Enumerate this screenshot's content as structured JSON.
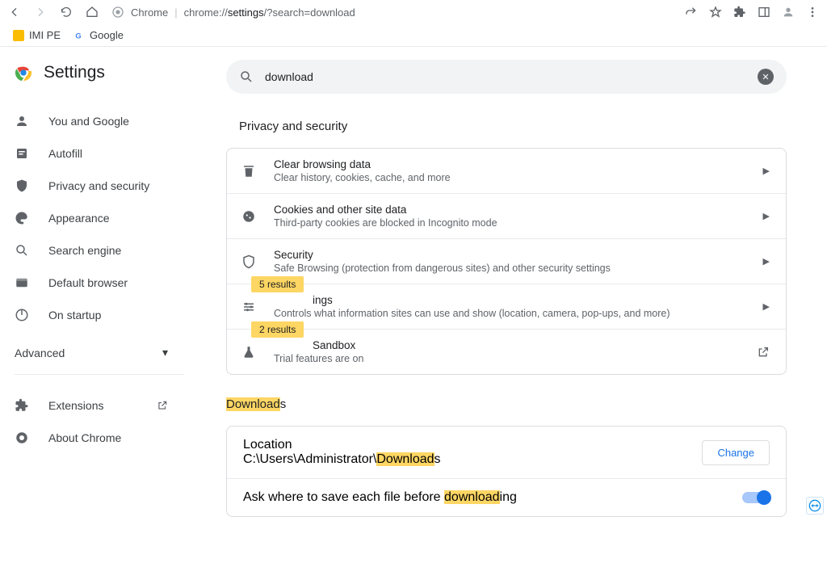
{
  "browser": {
    "url_prefix": "Chrome",
    "url_mid": "chrome://",
    "url_strong": "settings",
    "url_suffix": "/?search=download",
    "bookmarks": [
      {
        "label": "IMI PE"
      },
      {
        "label": "Google"
      }
    ]
  },
  "sidebar": {
    "title": "Settings",
    "items": [
      {
        "label": "You and Google"
      },
      {
        "label": "Autofill"
      },
      {
        "label": "Privacy and security"
      },
      {
        "label": "Appearance"
      },
      {
        "label": "Search engine"
      },
      {
        "label": "Default browser"
      },
      {
        "label": "On startup"
      }
    ],
    "advanced": "Advanced",
    "extensions": "Extensions",
    "about": "About Chrome"
  },
  "search": {
    "value": "download"
  },
  "sections": {
    "privacy": {
      "heading": "Privacy and security",
      "rows": [
        {
          "title": "Clear browsing data",
          "sub": "Clear history, cookies, cache, and more"
        },
        {
          "title": "Cookies and other site data",
          "sub": "Third-party cookies are blocked in Incognito mode"
        },
        {
          "title": "Security",
          "sub": "Safe Browsing (protection from dangerous sites) and other security settings"
        },
        {
          "title": "ings",
          "sub": "Controls what information sites can use and show (location, camera, pop-ups, and more)",
          "badge": "5 results"
        },
        {
          "title": "Sandbox",
          "sub": "Trial features are on",
          "badge": "2 results"
        }
      ]
    },
    "downloads": {
      "heading_pre": "Download",
      "heading_suf": "s",
      "location_label": "Location",
      "location_pre": "C:\\Users\\Administrator\\",
      "location_hl": "Download",
      "location_suf": "s",
      "change": "Change",
      "ask_pre": "Ask where to save each file before ",
      "ask_hl": "download",
      "ask_suf": "ing"
    }
  }
}
